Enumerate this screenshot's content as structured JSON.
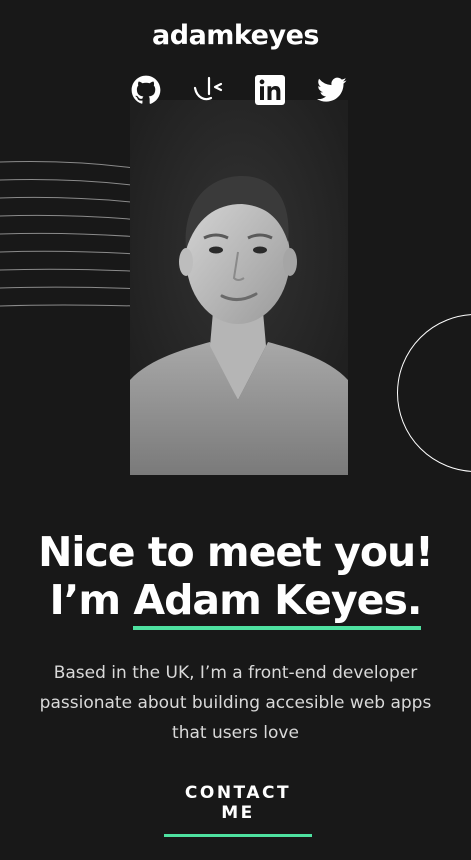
{
  "header": {
    "logo_text": "adamkeyes"
  },
  "socials": [
    {
      "icon": "github-icon"
    },
    {
      "icon": "frontend-mentor-icon"
    },
    {
      "icon": "linkedin-icon"
    },
    {
      "icon": "twitter-icon"
    }
  ],
  "hero": {
    "headline_line1": "Nice to meet you!",
    "headline_prefix": "I’m ",
    "headline_name": "Adam Keyes.",
    "bio": "Based in the UK, I’m a front-end developer passionate about building accesible web apps that users love",
    "contact_label": "CONTACT ME"
  },
  "colors": {
    "background": "#181818",
    "accent": "#4ee1a0",
    "text": "#ffffff",
    "body_text": "#d9d9d9"
  }
}
